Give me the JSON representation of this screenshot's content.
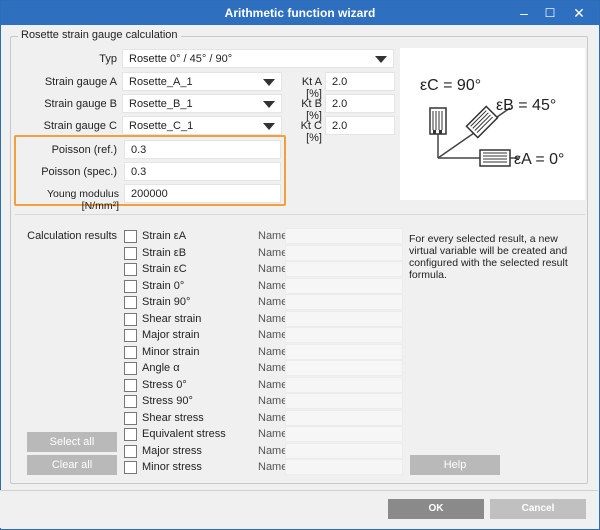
{
  "window": {
    "title": "Arithmetic function wizard",
    "controls": {
      "minimize": "–",
      "maximize": "☐",
      "close": "✕"
    }
  },
  "group": {
    "legend": "Rosette strain gauge calculation"
  },
  "form": {
    "typ": {
      "label": "Typ",
      "value": "Rosette 0° / 45° / 90°"
    },
    "gauge_a": {
      "label": "Strain gauge A",
      "value": "Rosette_A_1",
      "kt_label": "Kt A [%]",
      "kt_value": "2.0"
    },
    "gauge_b": {
      "label": "Strain gauge B",
      "value": "Rosette_B_1",
      "kt_label": "Kt B [%]",
      "kt_value": "2.0"
    },
    "gauge_c": {
      "label": "Strain gauge C",
      "value": "Rosette_C_1",
      "kt_label": "Kt C [%]",
      "kt_value": "2.0"
    },
    "poisson_ref": {
      "label": "Poisson (ref.)",
      "value": "0.3"
    },
    "poisson_spec": {
      "label": "Poisson (spec.)",
      "value": "0.3"
    },
    "young": {
      "label": "Young modulus [N/mm²]",
      "value": "200000"
    }
  },
  "diagram": {
    "eps_c": "εC = 90°",
    "eps_b": "εB = 45°",
    "eps_a": "εA = 0°"
  },
  "results": {
    "label": "Calculation results",
    "name_label": "Name:",
    "items": [
      "Strain εA",
      "Strain εB",
      "Strain εC",
      "Strain 0°",
      "Strain 90°",
      "Shear strain",
      "Major strain",
      "Minor strain",
      "Angle α",
      "Stress 0°",
      "Stress 90°",
      "Shear stress",
      "Equivalent stress",
      "Major stress",
      "Minor stress"
    ],
    "info": "For every selected result, a new virtual variable will be created and configured with the selected result formula.",
    "select_all": "Select all",
    "clear_all": "Clear all",
    "help": "Help"
  },
  "footer": {
    "ok": "OK",
    "cancel": "Cancel"
  },
  "colors": {
    "titlebar": "#2e6fbf",
    "highlight": "#f0a03c",
    "button_disabled": "#b9b9b9"
  }
}
